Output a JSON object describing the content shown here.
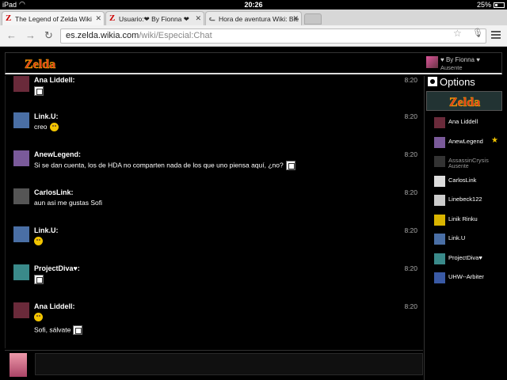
{
  "status_bar": {
    "carrier": "iPad",
    "time": "20:26",
    "battery": "25%"
  },
  "tabs": [
    {
      "title": "The Legend of Zelda Wiki",
      "favicon": "Z",
      "icon": "zelda-favicon"
    },
    {
      "title": "Usuario:❤ By Fionna ❤",
      "favicon": "Z",
      "icon": "zelda-favicon"
    },
    {
      "title": "Hora de aventura Wiki: Bie",
      "favicon": "ᓚ",
      "icon": "cat-favicon"
    }
  ],
  "toolbar": {
    "url_host": "es.zelda.wikia.com",
    "url_path": "/wiki/Especial:Chat"
  },
  "header": {
    "logo_text": "Zelda",
    "user_name": "♥ By Fionna ♥",
    "user_status": "Ausente"
  },
  "messages": [
    {
      "author": "Ana Liddell:",
      "time": "8:20",
      "lines": [
        {
          "text": "",
          "emote": "img"
        }
      ],
      "color": "#6a2a3a"
    },
    {
      "author": "Link.U:",
      "time": "8:20",
      "lines": [
        {
          "text": "creo",
          "emote": "face"
        }
      ],
      "color": "#4a6fa5"
    },
    {
      "author": "AnewLegend:",
      "time": "8:20",
      "lines": [
        {
          "text": "Si se dan cuenta, los de HDA no comparten nada de los que uno piensa aquí, ¿no?",
          "emote": "img"
        }
      ],
      "color": "#7a5a9a"
    },
    {
      "author": "CarlosLink:",
      "time": "8:20",
      "lines": [
        {
          "text": "aun asi me gustas Sofi",
          "emote": ""
        }
      ],
      "color": "#555555"
    },
    {
      "author": "Link.U:",
      "time": "8:20",
      "lines": [
        {
          "text": "",
          "emote": "face"
        }
      ],
      "color": "#4a6fa5"
    },
    {
      "author": "ProjectDiva♥:",
      "time": "8:20",
      "lines": [
        {
          "text": "",
          "emote": "img"
        }
      ],
      "color": "#3a8a8a"
    },
    {
      "author": "Ana Liddell:",
      "time": "8:20",
      "lines": [
        {
          "text": "",
          "emote": "face"
        },
        {
          "text": "Sofi, sálvate",
          "emote": "img"
        }
      ],
      "color": "#6a2a3a"
    }
  ],
  "sidebar": {
    "options_label": "Options",
    "users": [
      {
        "name": "Ana Liddell",
        "status": "",
        "color": "#6a2a3a",
        "star": false
      },
      {
        "name": "AnewLegend",
        "status": "",
        "color": "#7a5a9a",
        "star": true
      },
      {
        "name": "AssassinCrysis",
        "status": "Ausente",
        "color": "#333333",
        "star": false
      },
      {
        "name": "CarlosLink",
        "status": "",
        "color": "#dddddd",
        "star": false
      },
      {
        "name": "Linebeck122",
        "status": "",
        "color": "#cccccc",
        "star": false
      },
      {
        "name": "Linik Rinku",
        "status": "",
        "color": "#d9b400",
        "star": false
      },
      {
        "name": "Link.U",
        "status": "",
        "color": "#4a6fa5",
        "star": false
      },
      {
        "name": "ProjectDiva♥",
        "status": "",
        "color": "#3a8a8a",
        "star": false
      },
      {
        "name": "UHW--Arbiter",
        "status": "",
        "color": "#3a5aa5",
        "star": false
      }
    ]
  }
}
